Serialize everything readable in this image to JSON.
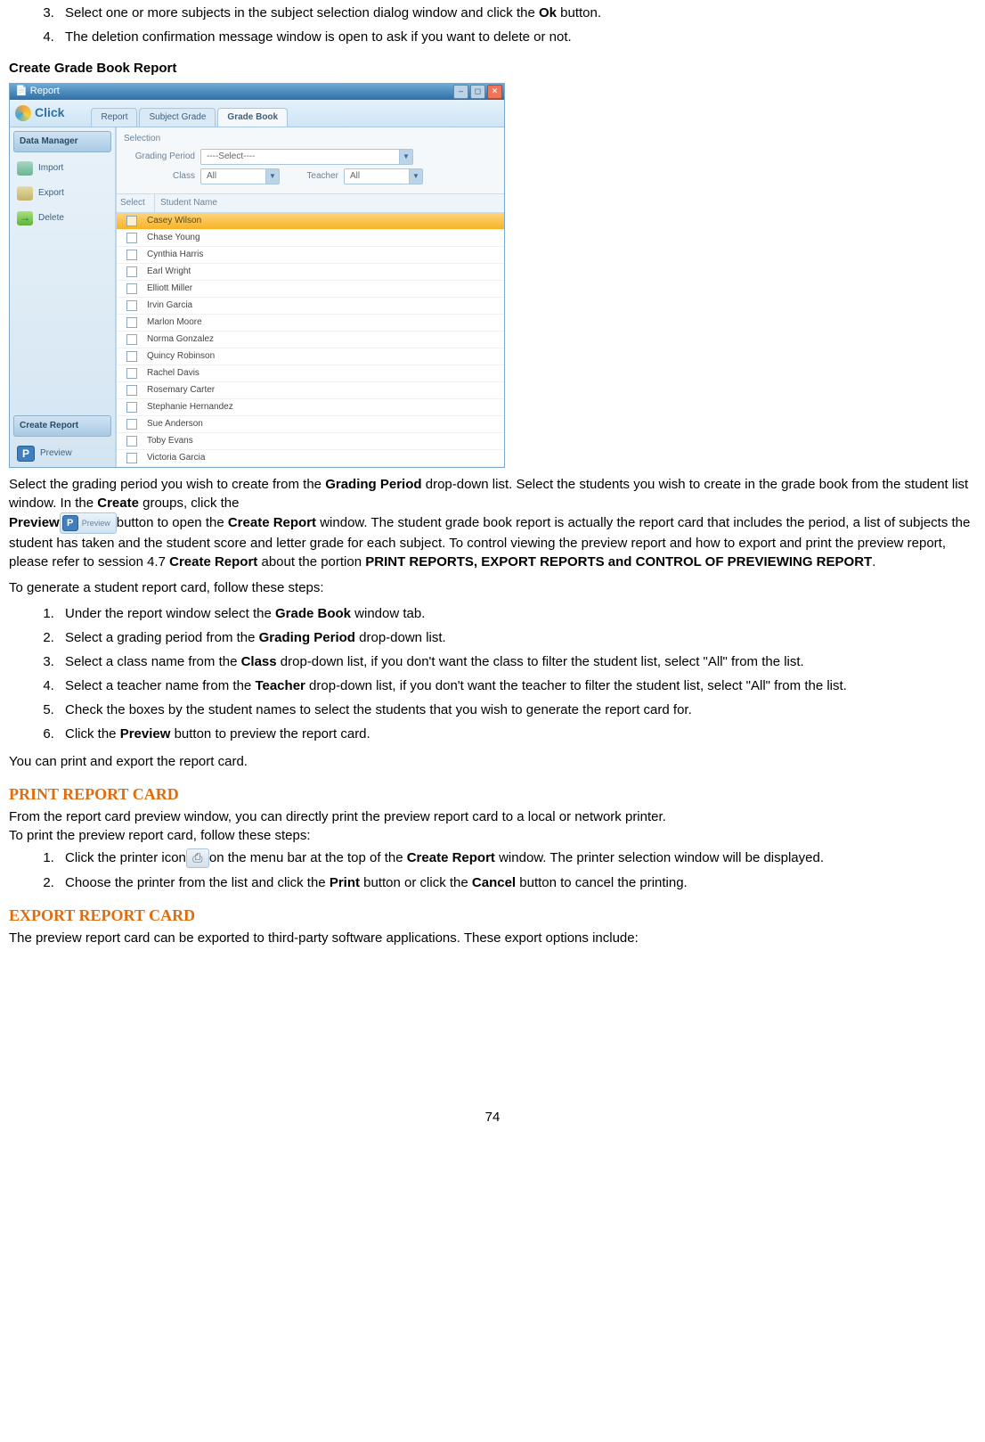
{
  "intro_list": {
    "start": 3,
    "items": [
      {
        "pre": "Select one or more subjects in the subject selection dialog window and click the ",
        "bold": "Ok",
        "post": " button."
      },
      {
        "pre": "The deletion confirmation message window is open to ask if you want to delete or not.",
        "bold": "",
        "post": ""
      }
    ]
  },
  "section_title": "Create Grade Book Report",
  "app": {
    "title": "Report",
    "logo": "Click",
    "tabs": [
      "Report",
      "Subject Grade",
      "Grade Book"
    ],
    "active_tab_index": 2,
    "sidebar": {
      "header1": "Data Manager",
      "items1": [
        {
          "icon": "ic-import",
          "label": "Import"
        },
        {
          "icon": "ic-export",
          "label": "Export"
        },
        {
          "icon": "ic-delete",
          "label": "Delete"
        }
      ],
      "header2": "Create Report",
      "items2": [
        {
          "icon": "ic-preview",
          "glyph": "P",
          "label": "Preview"
        }
      ]
    },
    "selection": {
      "title": "Selection",
      "grading_period_label": "Grading Period",
      "grading_period_value": "----Select----",
      "class_label": "Class",
      "class_value": "All",
      "teacher_label": "Teacher",
      "teacher_value": "All"
    },
    "list": {
      "col_select": "Select",
      "col_name": "Student Name",
      "rows": [
        {
          "name": "Casey Wilson",
          "selected": true
        },
        {
          "name": "Chase Young",
          "selected": false
        },
        {
          "name": "Cynthia Harris",
          "selected": false
        },
        {
          "name": "Earl Wright",
          "selected": false
        },
        {
          "name": "Elliott Miller",
          "selected": false
        },
        {
          "name": "Irvin Garcia",
          "selected": false
        },
        {
          "name": "Marlon Moore",
          "selected": false
        },
        {
          "name": "Norma Gonzalez",
          "selected": false
        },
        {
          "name": "Quincy Robinson",
          "selected": false
        },
        {
          "name": "Rachel Davis",
          "selected": false
        },
        {
          "name": "Rosemary Carter",
          "selected": false
        },
        {
          "name": "Stephanie Hernandez",
          "selected": false
        },
        {
          "name": "Sue Anderson",
          "selected": false
        },
        {
          "name": "Toby Evans",
          "selected": false
        },
        {
          "name": "Victoria Garcia",
          "selected": false
        }
      ]
    }
  },
  "para1": {
    "t1": "Select the grading period you wish to create from the ",
    "b1": "Grading Period",
    "t2": " drop-down list. Select the students you wish to create in the grade book from the student list window. In the ",
    "b2": "Create",
    "t3": " groups, click the ",
    "b3": "Preview",
    "btn_preview_label": "Preview",
    "btn_preview_glyph": "P",
    "t4": "button to open the ",
    "b4": "Create Report",
    "t5": " window. The student grade book report is actually the report card that includes the period, a list of subjects the student has taken and the student score and letter grade for each subject. To control viewing the preview report and how to export and print the preview report, please refer to session 4.7 ",
    "b5": "Create Report",
    "t6": " about the portion ",
    "b6": "PRINT REPORTS, EXPORT REPORTS and CONTROL OF PREVIEWING REPORT",
    "t7": "."
  },
  "steps_intro": "To generate a student report card, follow these steps:",
  "steps": [
    {
      "t1": "Under the report window select the ",
      "b1": "Grade Book",
      "t2": " window tab."
    },
    {
      "t1": "Select a grading period from the ",
      "b1": "Grading Period",
      "t2": " drop-down list."
    },
    {
      "t1": "Select a class name from the ",
      "b1": "Class",
      "t2": " drop-down list, if you don't want the class to filter the student list, select \"All\" from the list."
    },
    {
      "t1": "Select a teacher name from the ",
      "b1": "Teacher",
      "t2": " drop-down list, if you don't want the teacher to filter the student list, select \"All\" from the list."
    },
    {
      "t1": "Check the boxes by the student names to select the students that you wish to generate the report card for.",
      "b1": "",
      "t2": ""
    },
    {
      "t1": "Click the ",
      "b1": "Preview",
      "t2": " button to preview the report card."
    }
  ],
  "para2": "You can print and export the report card.",
  "h_print": "PRINT REPORT CARD",
  "print_intro1": "From the report card preview window, you can directly print the preview report card to a local or network printer.",
  "print_intro2": "To print the preview report card, follow these steps:",
  "print_steps": [
    {
      "t1": "Click the printer icon",
      "printer_glyph": "⎙",
      "t2": "on the menu bar at the top of the ",
      "b1": "Create Report",
      "t3": " window.   The printer selection window will be displayed."
    },
    {
      "t1": "Choose the printer from the list and click the ",
      "b1": "Print",
      "t2": " button or click the ",
      "b2": "Cancel",
      "t3": " button to cancel the printing."
    }
  ],
  "h_export": "EXPORT REPORT CARD",
  "export_p": "The preview report card can be exported to third-party software applications. These export options include:",
  "page_number": "74"
}
